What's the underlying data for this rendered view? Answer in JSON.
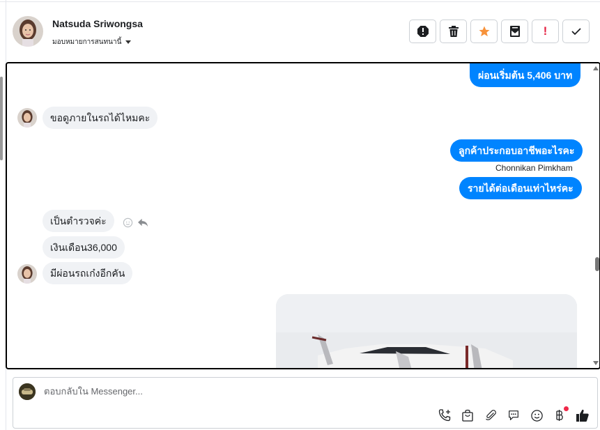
{
  "header": {
    "contact_name": "Natsuda Sriwongsa",
    "assign_label": "มอบหมายการสนทนานี้",
    "actions": [
      {
        "name": "spam-icon"
      },
      {
        "name": "trash-icon"
      },
      {
        "name": "star-icon"
      },
      {
        "name": "mark-unread-icon"
      },
      {
        "name": "follow-up-icon",
        "text": "!"
      },
      {
        "name": "done-check-icon"
      }
    ]
  },
  "messages": {
    "out_1": "ผ่อนเริ่มต้น 5,406 บาท",
    "in_1": "ขอดูภายในรถได้ไหมคะ",
    "out_2": "ลูกค้าประกอบอาชีพอะไรคะ",
    "out_2_sender": "Chonnikan Pimkham",
    "out_3": "รายได้ต่อเดือนเท่าไหร่คะ",
    "in_2": "เป็นตำรวจค่ะ",
    "in_3": "เงินเดือน36,000",
    "in_4": "มีผ่อนรถเก๋งอีกคัน"
  },
  "composer": {
    "placeholder": "ตอบกลับใน Messenger...",
    "tools": [
      "call-plus-icon",
      "shopping-bag-icon",
      "attachment-icon",
      "saved-reply-icon",
      "emoji-icon",
      "baht-payment-icon",
      "like-icon"
    ]
  },
  "colors": {
    "accent": "#0084ff",
    "star": "#f7923a",
    "follow_up": "#e41e3f",
    "notification_dot": "#f02849"
  }
}
